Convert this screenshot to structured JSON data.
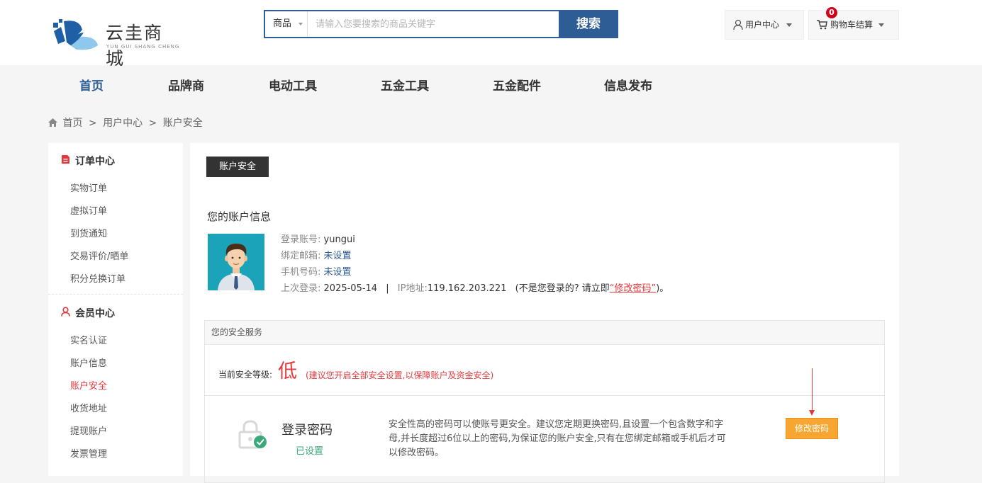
{
  "brand": {
    "name": "云圭商城",
    "subtitle": "YUN GUI SHANG CHENG",
    "colors": {
      "primary": "#2d5d94",
      "logo_blue": "#1e5fa5",
      "logo_light": "#8ec8ec",
      "alert": "#e4393c",
      "button_orange": "#f7a631",
      "success": "#3aa87a"
    }
  },
  "search": {
    "category": "商品",
    "placeholder": "请输入您要搜索的商品关键字",
    "button": "搜索"
  },
  "header": {
    "user_center": "用户中心",
    "cart_label": "购物车结算",
    "cart_count": "0",
    "user_icon": "user-icon",
    "cart_icon": "cart-icon"
  },
  "nav": {
    "items": [
      "首页",
      "品牌商",
      "电动工具",
      "五金工具",
      "五金配件",
      "信息发布"
    ]
  },
  "breadcrumb": {
    "home": "首页",
    "sep": ">",
    "level2": "用户中心",
    "level3": "账户安全"
  },
  "sidebar": {
    "order_center": {
      "title": "订单中心",
      "items": [
        "实物订单",
        "虚拟订单",
        "到货通知",
        "交易评价/晒单",
        "积分兑换订单"
      ]
    },
    "member_center": {
      "title": "会员中心",
      "items": [
        "实名认证",
        "账户信息",
        "账户安全",
        "收货地址",
        "提现账户",
        "发票管理"
      ],
      "active_index": 2
    }
  },
  "main": {
    "tab": "账户安全",
    "account_title": "您的账户信息",
    "login_label": "登录账号:",
    "login_value": "yungui",
    "email_label": "绑定邮箱:",
    "email_value": "未设置",
    "phone_label": "手机号码:",
    "phone_value": "未设置",
    "last_login_label": "上次登录:",
    "last_login_date": "2025-05-14",
    "separator": "|",
    "ip_label": "IP地址:",
    "ip_value": "119.162.203.221",
    "warn_prefix": "(不是您登录的? 请立即",
    "warn_link": "“修改密码”",
    "warn_suffix": ")。",
    "security_title": "您的安全服务",
    "level_label": "当前安全等级:",
    "level_value": "低",
    "level_tip": "(建议您开启全部安全设置,以保障账户及资金安全)",
    "password": {
      "title": "登录密码",
      "status": "已设置",
      "desc": "安全性高的密码可以使账号更安全。建议您定期更换密码,且设置一个包含数字和字母,并长度超过6位以上的密码,为保证您的账户安全,只有在您绑定邮箱或手机后才可以修改密码。",
      "button": "修改密码"
    }
  }
}
